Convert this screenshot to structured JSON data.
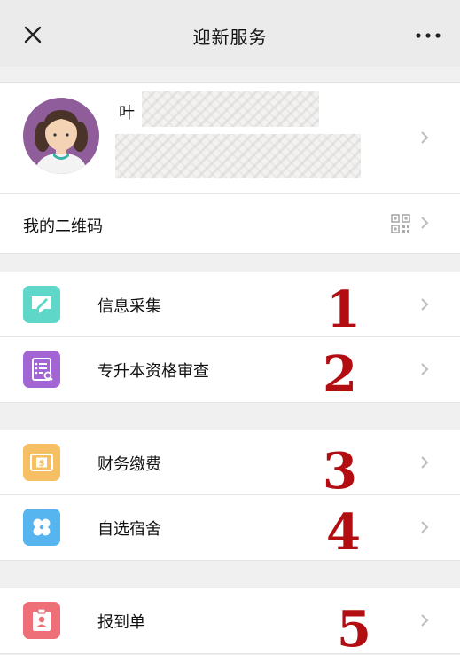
{
  "header": {
    "title": "迎新服务"
  },
  "profile": {
    "name_visible": "叶"
  },
  "qr": {
    "label": "我的二维码"
  },
  "groups": [
    {
      "items": [
        {
          "label": "信息采集",
          "number": "1",
          "icon": "edit-icon",
          "color": "#5ed6c8"
        },
        {
          "label": "专升本资格审查",
          "number": "2",
          "icon": "checklist-icon",
          "color": "#a265d3"
        }
      ]
    },
    {
      "items": [
        {
          "label": "财务缴费",
          "number": "3",
          "icon": "payment-icon",
          "color": "#f5c063"
        },
        {
          "label": "自选宿舍",
          "number": "4",
          "icon": "dorm-icon",
          "color": "#56b4ef"
        }
      ]
    },
    {
      "items": [
        {
          "label": "报到单",
          "number": "5",
          "icon": "badge-icon",
          "color": "#ee6f77"
        }
      ]
    }
  ]
}
